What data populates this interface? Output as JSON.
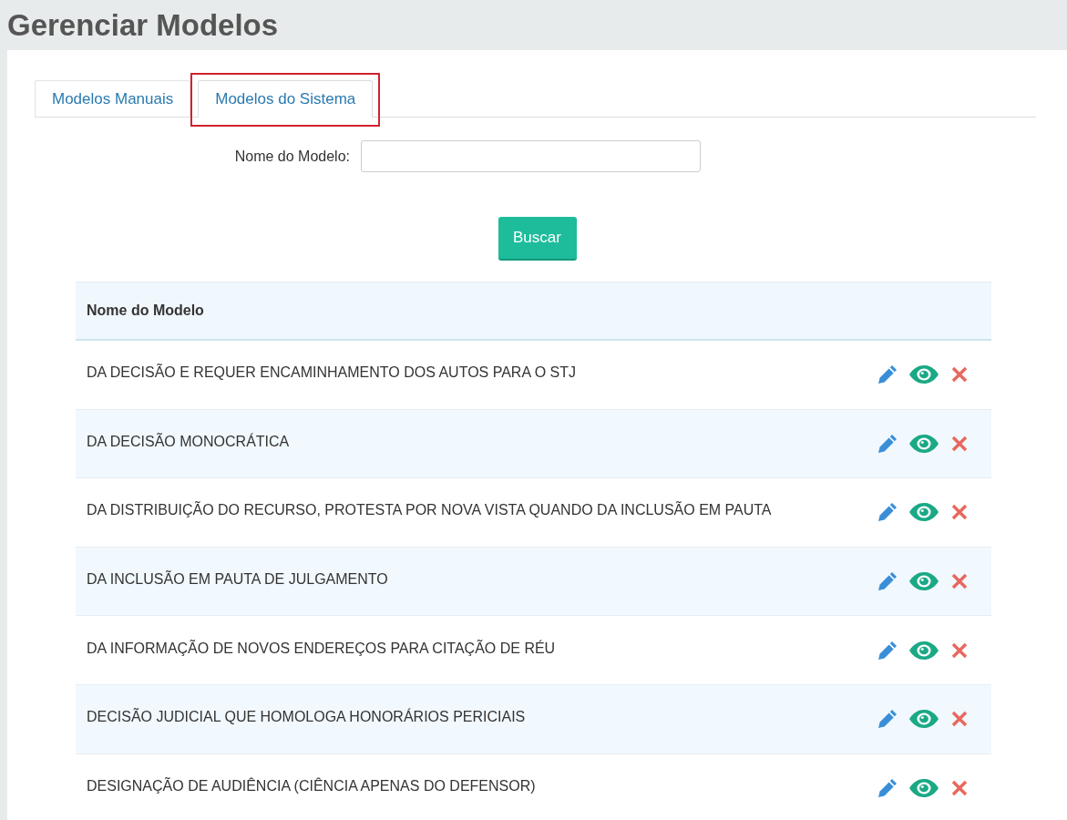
{
  "page_title": "Gerenciar Modelos",
  "tabs": [
    {
      "label": "Modelos Manuais",
      "selected": false,
      "highlighted": false
    },
    {
      "label": "Modelos do Sistema",
      "selected": true,
      "highlighted": true
    }
  ],
  "search": {
    "label": "Nome do Modelo:",
    "button": "Buscar"
  },
  "table": {
    "columns": [
      "Nome do Modelo"
    ],
    "rows": [
      {
        "name": "DA DECISÃO E REQUER ENCAMINHAMENTO DOS AUTOS PARA O STJ"
      },
      {
        "name": "DA DECISÃO MONOCRÁTICA"
      },
      {
        "name": "DA DISTRIBUIÇÃO DO RECURSO, PROTESTA POR NOVA VISTA QUANDO DA INCLUSÃO EM PAUTA"
      },
      {
        "name": "DA INCLUSÃO EM PAUTA DE JULGAMENTO"
      },
      {
        "name": "DA INFORMAÇÃO DE NOVOS ENDEREÇOS PARA CITAÇÃO DE RÉU"
      },
      {
        "name": "DECISÃO JUDICIAL QUE HOMOLOGA HONORÁRIOS PERICIAIS"
      },
      {
        "name": "DESIGNAÇÃO DE AUDIÊNCIA (CIÊNCIA APENAS DO DEFENSOR)"
      }
    ]
  }
}
